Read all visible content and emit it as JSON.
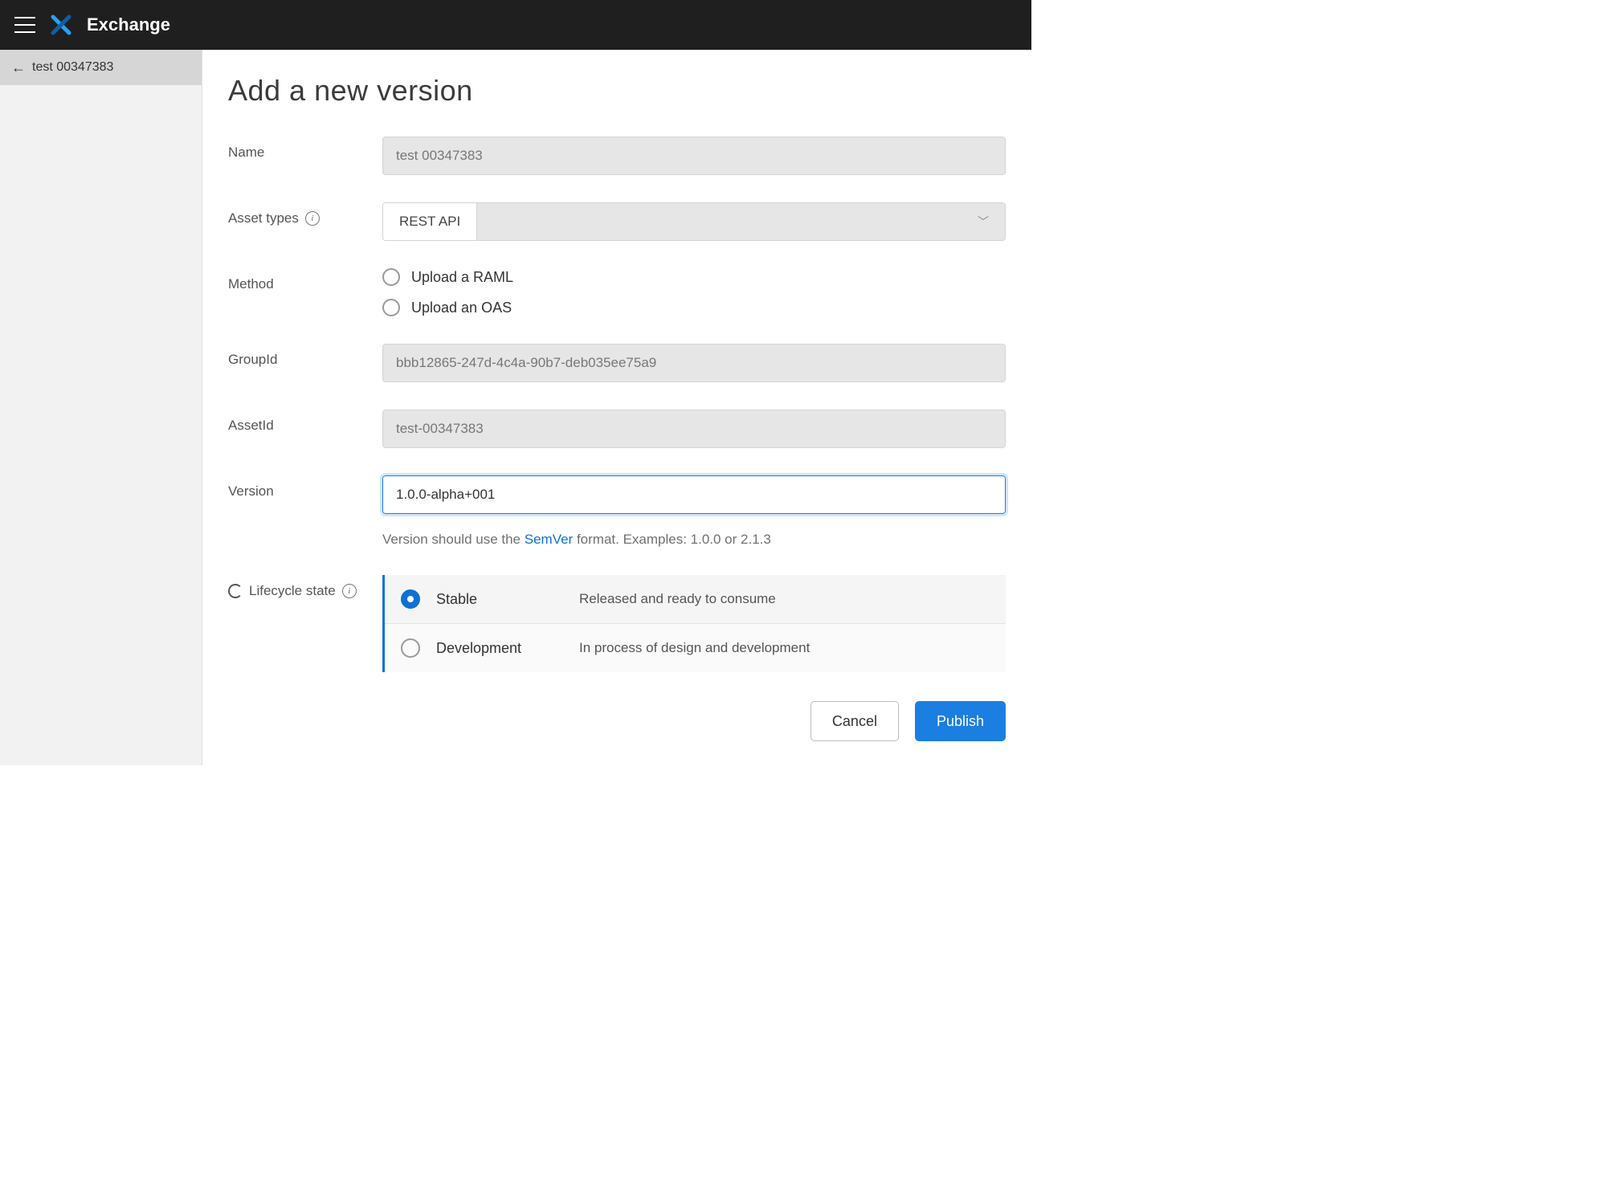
{
  "header": {
    "app_title": "Exchange"
  },
  "sidebar": {
    "back_label": "test 00347383"
  },
  "page": {
    "title": "Add a new version"
  },
  "form": {
    "name": {
      "label": "Name",
      "value": "test 00347383"
    },
    "asset_types": {
      "label": "Asset types",
      "selected": "REST API"
    },
    "method": {
      "label": "Method",
      "options": [
        "Upload a RAML",
        "Upload an OAS"
      ]
    },
    "group_id": {
      "label": "GroupId",
      "value": "bbb12865-247d-4c4a-90b7-deb035ee75a9"
    },
    "asset_id": {
      "label": "AssetId",
      "value": "test-00347383"
    },
    "version": {
      "label": "Version",
      "value": "1.0.0-alpha+001",
      "hint_prefix": "Version should use the ",
      "hint_link": "SemVer",
      "hint_suffix": " format. Examples: 1.0.0 or 2.1.3"
    },
    "lifecycle": {
      "label": "Lifecycle state",
      "states": [
        {
          "name": "Stable",
          "desc": "Released and ready to consume"
        },
        {
          "name": "Development",
          "desc": "In process of design and development"
        }
      ]
    }
  },
  "footer": {
    "cancel": "Cancel",
    "publish": "Publish"
  }
}
